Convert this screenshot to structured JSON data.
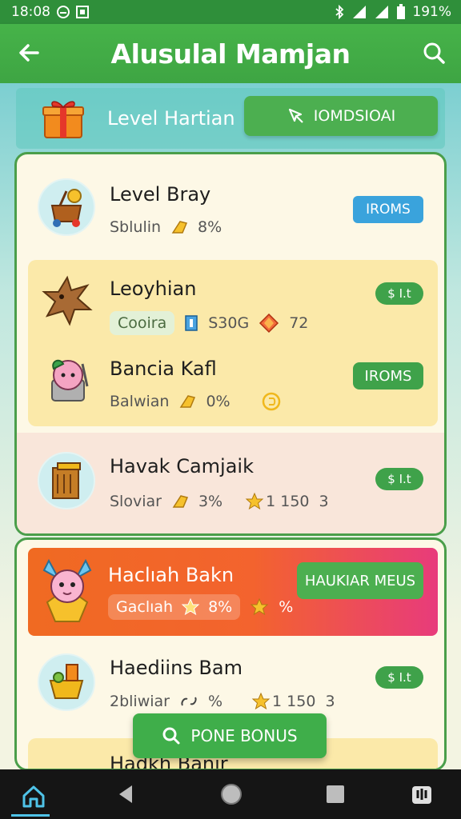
{
  "status_bar": {
    "time": "18:08",
    "battery": "191%"
  },
  "header": {
    "title": "Alusulal Mamjan"
  },
  "level_banner": {
    "label": "Level Hartian",
    "button_label": "IOMDSIOAI"
  },
  "rows": [
    {
      "title": "Level Bray",
      "sub_a": "Sblulin",
      "sub_b": "8%",
      "badge": "IROMS"
    },
    {
      "title": "Leoyhian",
      "sub_a": "Cooira",
      "sub_b": "S30G",
      "sub_c": "72",
      "badge": "$ I.t"
    },
    {
      "title": "Bancia Kafl",
      "sub_a": "Balwian",
      "sub_b": "0%",
      "badge": "IROMS"
    },
    {
      "title": "Havak Camjaik",
      "sub_a": "Sloviar",
      "sub_b": "3%",
      "sub_c": "1 150",
      "sub_d": "3",
      "badge": "$ I.t"
    }
  ],
  "promo": {
    "title": "Haclıah Bakn",
    "sub_a": "Gaclıah",
    "sub_b": "8%",
    "sub_c": "%",
    "button_label": "HAUKIAR MEUS"
  },
  "row_b2": {
    "title": "Haediins Bam",
    "sub_a": "2bliwiar",
    "sub_b": "%",
    "sub_c": "1 150",
    "sub_d": "3",
    "badge": "$ I.t"
  },
  "row_b3": {
    "title": "Hadkh Banir"
  },
  "fab": {
    "label": "PONE BONUS"
  },
  "colors": {
    "primary": "#3fae4a",
    "header": "#46b349",
    "badge_blue": "#3aa3dc",
    "promo": "#f06a22"
  }
}
